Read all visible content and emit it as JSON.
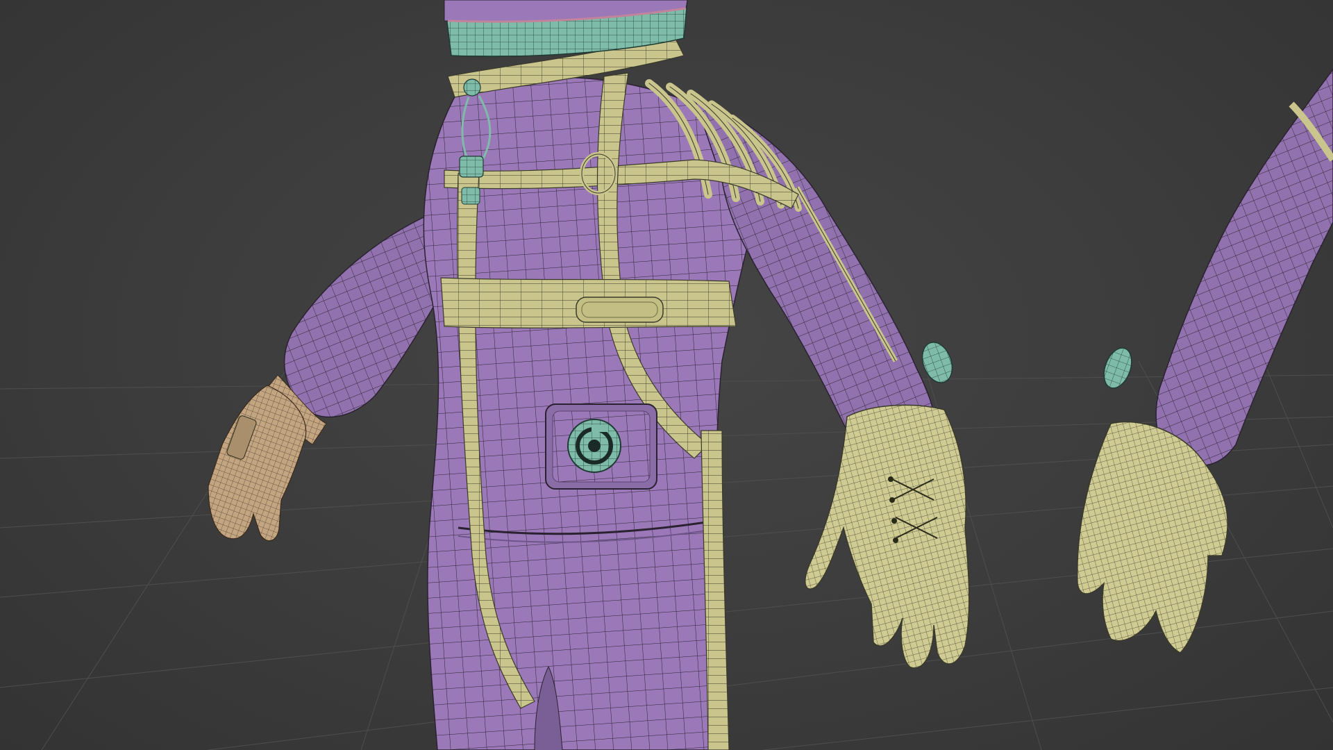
{
  "viewport": {
    "background": "#3c3c3c",
    "grid": "on",
    "grid_color": "#4e4e4e",
    "display_mode": "shaded-with-wireframe"
  },
  "materials": {
    "suit": "#9b78b8",
    "straps_and_gloves": "#c9c58c",
    "fittings": "#7ebba8",
    "bare_hand": "#c4a582",
    "wire": "#1a1a1a"
  },
  "icons": {
    "chest_patch": "chest-valve-icon"
  }
}
